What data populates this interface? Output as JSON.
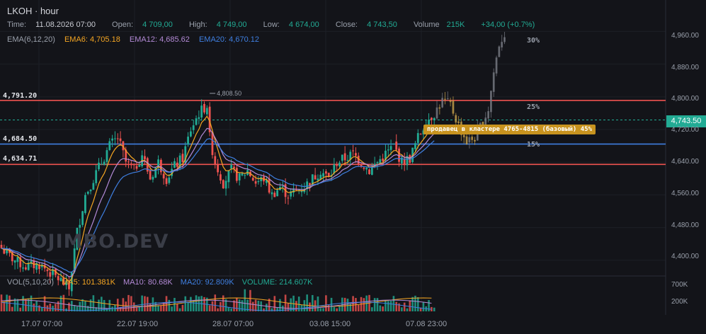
{
  "header": {
    "symbol": "LKOH · hour",
    "time_label": "Time:",
    "time": "11.08.2026 07:00",
    "open_label": "Open:",
    "open": "4 709,00",
    "high_label": "High:",
    "high": "4 749,00",
    "low_label": "Low:",
    "low": "4 674,00",
    "close_label": "Close:",
    "close": "4 743,50",
    "volume_label": "Volume",
    "volume": "215K",
    "change": "+34,00 (+0.7%)"
  },
  "ema_legend": {
    "name": "EMA(6,12,20)",
    "ema6": "EMA6: 4,705.18",
    "ema12": "EMA12: 4,685.62",
    "ema20": "EMA20: 4,670.12"
  },
  "vol_legend": {
    "name": "VOL(5,10,20)",
    "ma5": "MA5: 101.381K",
    "ma10": "MA10: 80.68K",
    "ma20": "MA20: 92.809K",
    "volume": "VOLUME: 214.607K"
  },
  "watermark": "YOJIMBO.DEV",
  "levels": {
    "l1": "4,791.20",
    "l2": "4,684.50",
    "l3": "4,634.71",
    "peak": "4,808.50"
  },
  "price_tag": "4,743.50",
  "annotation": "продавец в кластере 4765-4815 (базовый) 45%",
  "percent_labels": [
    "30%",
    "25%",
    "15%"
  ],
  "colors": {
    "up": "#22ab94",
    "down": "#ef5350",
    "ema6": "#f5a623",
    "ema12": "#b38ad6",
    "ema20": "#3f7fe0",
    "level_red": "#ef5350",
    "level_blue": "#3f7fe0",
    "annotation": "#c8931f"
  },
  "chart_data": {
    "type": "candlestick",
    "y_axis_ticks": [
      "4,960.00",
      "4,880.00",
      "4,800.00",
      "4,720.00",
      "4,640.00",
      "4,560.00",
      "4,480.00",
      "4,400.00"
    ],
    "y_tick_values": [
      4960,
      4880,
      4800,
      4720,
      4640,
      4560,
      4480,
      4400
    ],
    "volume_ticks": [
      "700K",
      "200K"
    ],
    "volume_tick_values": [
      700000,
      200000
    ],
    "x_axis_ticks": [
      "17.07 07:00",
      "22.07 19:00",
      "28.07 07:00",
      "03.08 15:00",
      "07.08 23:00"
    ],
    "ylim": [
      4365,
      4985
    ],
    "horizontal_lines": [
      {
        "value": 4791.2,
        "color": "red"
      },
      {
        "value": 4684.5,
        "color": "blue"
      },
      {
        "value": 4634.71,
        "color": "red"
      }
    ],
    "current_price": 4743.5,
    "peak": 4808.5,
    "keypoints": [
      [
        0,
        4430
      ],
      [
        3,
        4410
      ],
      [
        6,
        4395
      ],
      [
        9,
        4385
      ],
      [
        14,
        4390
      ],
      [
        18,
        4370
      ],
      [
        22,
        4350
      ],
      [
        25,
        4330
      ],
      [
        28,
        4470
      ],
      [
        31,
        4560
      ],
      [
        34,
        4600
      ],
      [
        37,
        4640
      ],
      [
        40,
        4680
      ],
      [
        43,
        4700
      ],
      [
        46,
        4640
      ],
      [
        49,
        4620
      ],
      [
        52,
        4660
      ],
      [
        55,
        4600
      ],
      [
        58,
        4640
      ],
      [
        61,
        4600
      ],
      [
        64,
        4630
      ],
      [
        67,
        4650
      ],
      [
        70,
        4720
      ],
      [
        73,
        4760
      ],
      [
        76,
        4780
      ],
      [
        77,
        4700
      ],
      [
        79,
        4640
      ],
      [
        82,
        4590
      ],
      [
        85,
        4620
      ],
      [
        88,
        4600
      ],
      [
        91,
        4620
      ],
      [
        94,
        4590
      ],
      [
        97,
        4600
      ],
      [
        100,
        4560
      ],
      [
        103,
        4580
      ],
      [
        106,
        4560
      ],
      [
        109,
        4570
      ],
      [
        112,
        4580
      ],
      [
        115,
        4600
      ],
      [
        118,
        4620
      ],
      [
        121,
        4600
      ],
      [
        124,
        4640
      ],
      [
        127,
        4650
      ],
      [
        130,
        4660
      ],
      [
        133,
        4640
      ],
      [
        136,
        4620
      ],
      [
        139,
        4640
      ],
      [
        142,
        4660
      ],
      [
        145,
        4680
      ],
      [
        148,
        4640
      ],
      [
        151,
        4650
      ],
      [
        154,
        4700
      ],
      [
        157,
        4740
      ],
      [
        160,
        4760
      ],
      [
        163,
        4790
      ],
      [
        166,
        4780
      ],
      [
        169,
        4730
      ],
      [
        172,
        4690
      ],
      [
        175,
        4700
      ],
      [
        178,
        4740
      ],
      [
        180,
        4770
      ],
      [
        182,
        4860
      ],
      [
        184,
        4930
      ],
      [
        186,
        4955
      ]
    ],
    "forecast_start": 161
  }
}
